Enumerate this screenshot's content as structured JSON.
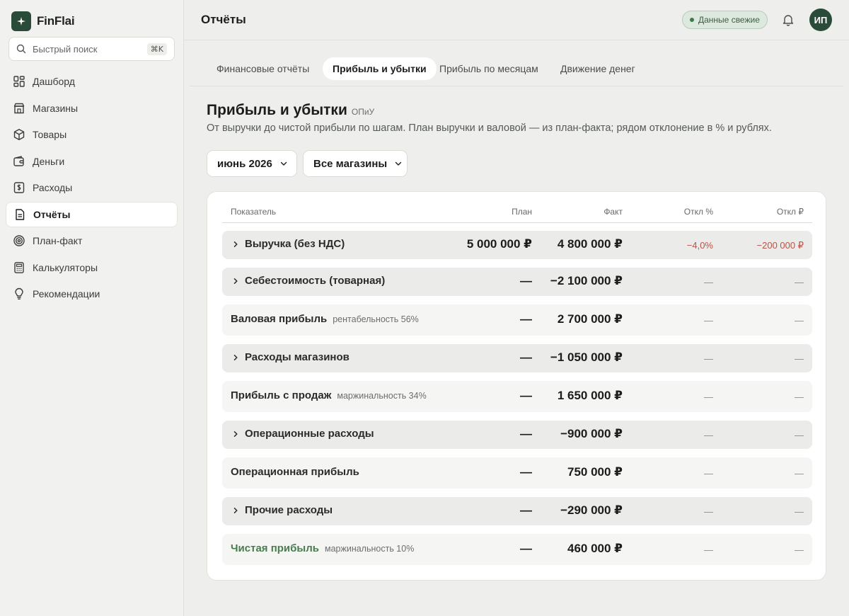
{
  "brand": {
    "name": "FinFlai"
  },
  "search": {
    "placeholder": "Быстрый поиск",
    "shortcut": "⌘K"
  },
  "sidebar": {
    "items": [
      {
        "label": "Дашборд",
        "icon": "dashboard-icon"
      },
      {
        "label": "Магазины",
        "icon": "store-icon"
      },
      {
        "label": "Товары",
        "icon": "box-icon"
      },
      {
        "label": "Деньги",
        "icon": "wallet-icon"
      },
      {
        "label": "Расходы",
        "icon": "expense-icon"
      },
      {
        "label": "Отчёты",
        "icon": "report-icon",
        "active": true
      },
      {
        "label": "План-факт",
        "icon": "target-icon"
      },
      {
        "label": "Калькуляторы",
        "icon": "calculator-icon"
      },
      {
        "label": "Рекомендации",
        "icon": "lightbulb-icon"
      }
    ]
  },
  "header": {
    "title": "Отчёты",
    "status": "Данные свежие",
    "avatar_initials": "ИП"
  },
  "tabs": [
    {
      "label": "Финансовые отчёты"
    },
    {
      "label": "Прибыль и убытки",
      "active": true
    },
    {
      "label": "Прибыль по месяцам"
    },
    {
      "label": "Движение денег"
    }
  ],
  "report": {
    "title": "Прибыль и убытки",
    "abbr": "ОПиУ",
    "description": "От выручки до чистой прибыли по шагам. План выручки и валовой — из план-факта; рядом отклонение в % и рублях.",
    "period": "июнь 2026",
    "stores": "Все магазины"
  },
  "table": {
    "columns": [
      "Показатель",
      "План",
      "Факт",
      "Откл %",
      "Откл ₽"
    ],
    "rows": [
      {
        "label": "Выручка (без НДС)",
        "note": "",
        "expandable": true,
        "plan": "5 000 000 ₽",
        "fact": "4 800 000 ₽",
        "dev_pct": "−4,0%",
        "dev_rub": "−200 000 ₽"
      },
      {
        "label": "Себестоимость (товарная)",
        "note": "",
        "expandable": true,
        "plan": "—",
        "fact": "−2 100 000 ₽",
        "dev_pct": "—",
        "dev_rub": "—"
      },
      {
        "label": "Валовая прибыль",
        "note": "рентабельность 56%",
        "expandable": false,
        "plan": "—",
        "fact": "2 700 000 ₽",
        "dev_pct": "—",
        "dev_rub": "—"
      },
      {
        "label": "Расходы магазинов",
        "note": "",
        "expandable": true,
        "plan": "—",
        "fact": "−1 050 000 ₽",
        "dev_pct": "—",
        "dev_rub": "—"
      },
      {
        "label": "Прибыль с продаж",
        "note": "маржинальность 34%",
        "expandable": false,
        "plan": "—",
        "fact": "1 650 000 ₽",
        "dev_pct": "—",
        "dev_rub": "—"
      },
      {
        "label": "Операционные расходы",
        "note": "",
        "expandable": true,
        "plan": "—",
        "fact": "−900 000 ₽",
        "dev_pct": "—",
        "dev_rub": "—"
      },
      {
        "label": "Операционная прибыль",
        "note": "",
        "expandable": false,
        "plan": "—",
        "fact": "750 000 ₽",
        "dev_pct": "—",
        "dev_rub": "—"
      },
      {
        "label": "Прочие расходы",
        "note": "",
        "expandable": true,
        "plan": "—",
        "fact": "−290 000 ₽",
        "dev_pct": "—",
        "dev_rub": "—"
      },
      {
        "label": "Чистая прибыль",
        "note": "маржинальность 10%",
        "expandable": false,
        "plan": "—",
        "fact": "460 000 ₽",
        "dev_pct": "—",
        "dev_rub": "—"
      }
    ]
  },
  "colors": {
    "brand": "#2a4b3a",
    "status_bg": "#dde8de",
    "negative": "#b5544a",
    "net_profit": "#4a7c4f"
  }
}
